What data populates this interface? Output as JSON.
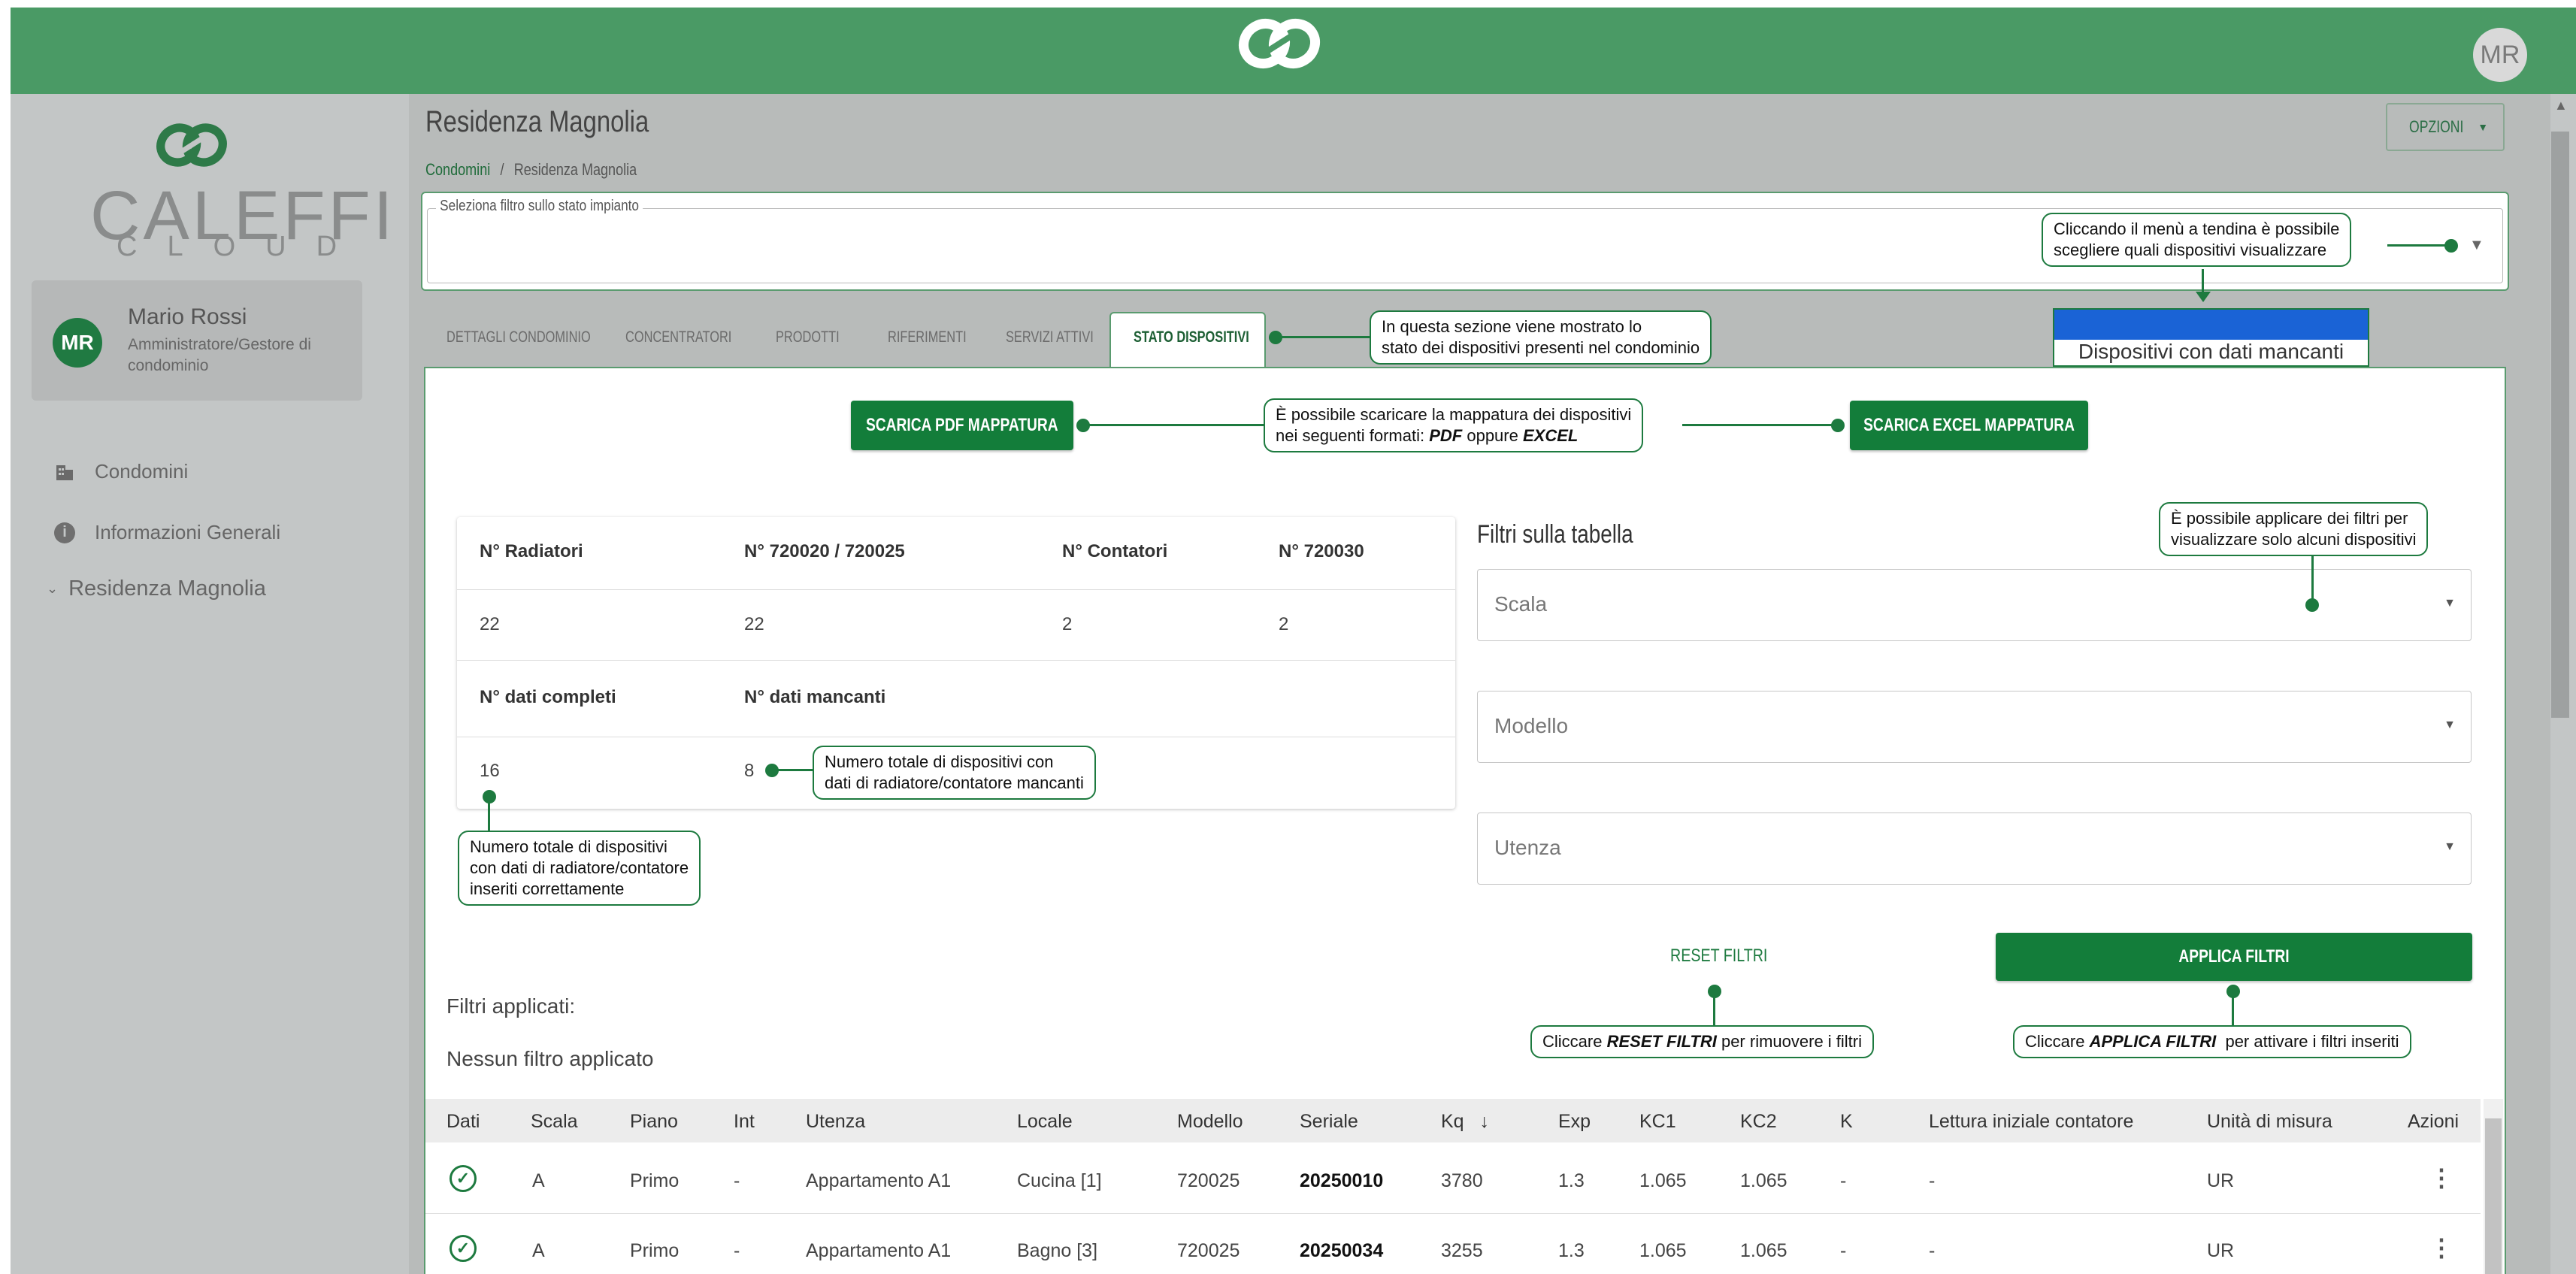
{
  "topbar": {
    "avatar_initials": "MR"
  },
  "sidebar": {
    "brand_main": "CALEFFI",
    "brand_sub": "CLOUD",
    "user": {
      "initials": "MR",
      "name": "Mario Rossi",
      "role": "Amministratore/Gestore di condominio"
    },
    "items": [
      {
        "label": "Condomini",
        "icon": "building-icon"
      },
      {
        "label": "Informazioni Generali",
        "icon": "info-icon"
      },
      {
        "label": "Residenza Magnolia",
        "icon": "chevron-down-icon"
      }
    ]
  },
  "header": {
    "title": "Residenza Magnolia",
    "breadcrumb": {
      "root": "Condomini",
      "separator": "/",
      "current": "Residenza Magnolia"
    },
    "options_button": "OPZIONI"
  },
  "filter_select": {
    "legend": "Seleziona filtro sullo stato impianto"
  },
  "dropdown": {
    "option": "Dispositivi con dati mancanti",
    "selected_color": "#1a63d6"
  },
  "tabs": [
    {
      "label": "DETTAGLI CONDOMINIO"
    },
    {
      "label": "CONCENTRATORI"
    },
    {
      "label": "PRODOTTI"
    },
    {
      "label": "RIFERIMENTI"
    },
    {
      "label": "SERVIZI ATTIVI"
    },
    {
      "label": "STATO DISPOSITIVI",
      "active": true
    }
  ],
  "buttons": {
    "pdf": "SCARICA PDF MAPPATURA",
    "excel": "SCARICA EXCEL MAPPATURA",
    "reset": "RESET FILTRI",
    "apply": "APPLICA FILTRI"
  },
  "stats": {
    "headers_row1": [
      "N° Radiatori",
      "N° 720020 / 720025",
      "N° Contatori",
      "N° 720030"
    ],
    "values_row1": [
      "22",
      "22",
      "2",
      "2"
    ],
    "headers_row2": [
      "N° dati completi",
      "N° dati mancanti"
    ],
    "values_row2": [
      "16",
      "8"
    ]
  },
  "filters": {
    "title": "Filtri sulla tabella",
    "scala": "Scala",
    "modello": "Modello",
    "utenza": "Utenza",
    "applied_label": "Filtri applicati:",
    "none_label": "Nessun filtro applicato"
  },
  "callouts": {
    "dropdown": [
      "Cliccando il menù a tendina è possibile",
      "scegliere quali dispositivi visualizzare"
    ],
    "section": [
      "In questa sezione viene mostrato lo",
      "stato dei dispositivi presenti nel condominio"
    ],
    "download": {
      "line1": "È possibile scaricare la mappatura dei dispositivi",
      "line2_pre": "nei seguenti formati: ",
      "pdf": "PDF",
      "mid": " oppure ",
      "excel": "EXCEL"
    },
    "filters": [
      "È possibile applicare dei filtri per",
      "visualizzare solo alcuni dispositivi"
    ],
    "missing": [
      "Numero totale di dispositivi con",
      "dati di radiatore/contatore mancanti"
    ],
    "complete": [
      "Numero totale di dispositivi",
      "con dati di radiatore/contatore",
      "inseriti correttamente"
    ],
    "reset": {
      "pre": "Cliccare ",
      "bold": "RESET FILTRI",
      "post": " per rimuovere i filtri"
    },
    "apply": {
      "pre": "Cliccare ",
      "bold": "APPLICA FILTRI",
      "post": "  per attivare i filtri inseriti"
    }
  },
  "table": {
    "columns": [
      "Dati",
      "Scala",
      "Piano",
      "Int",
      "Utenza",
      "Locale",
      "Modello",
      "Seriale",
      "Kq",
      "Exp",
      "KC1",
      "KC2",
      "K",
      "Lettura iniziale contatore",
      "Unità di misura",
      "Azioni"
    ],
    "sort_icon": "arrow-down-icon",
    "rows": [
      {
        "scala": "A",
        "piano": "Primo",
        "int": "-",
        "utenza": "Appartamento A1",
        "locale": "Cucina [1]",
        "modello": "720025",
        "seriale": "20250010",
        "kq": "3780",
        "exp": "1.3",
        "kc1": "1.065",
        "kc2": "1.065",
        "k": "-",
        "lettura": "-",
        "unita": "UR"
      },
      {
        "scala": "A",
        "piano": "Primo",
        "int": "-",
        "utenza": "Appartamento A1",
        "locale": "Bagno [3]",
        "modello": "720025",
        "seriale": "20250034",
        "kq": "3255",
        "exp": "1.3",
        "kc1": "1.065",
        "kc2": "1.065",
        "k": "-",
        "lettura": "-",
        "unita": "UR"
      }
    ]
  },
  "colors": {
    "brand_green": "#137d3a",
    "topbar": "#4a9a65",
    "callout_border": "#1d7a3f"
  }
}
